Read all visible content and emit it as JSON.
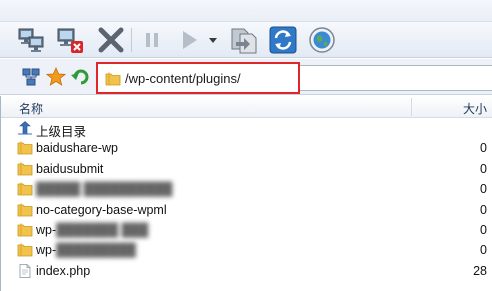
{
  "toolbar": {
    "buttons": [
      {
        "name": "connect-icon"
      },
      {
        "name": "disconnect-icon"
      },
      {
        "name": "cancel-icon"
      },
      {
        "name": "pause-icon"
      },
      {
        "name": "play-icon"
      },
      {
        "name": "dropdown-arrow-icon"
      },
      {
        "name": "copy-icon"
      },
      {
        "name": "refresh-icon"
      },
      {
        "name": "globe-icon"
      }
    ]
  },
  "address": {
    "path": "/wp-content/plugins/"
  },
  "list": {
    "header_name": "名称",
    "header_size": "大小",
    "up_label": "上级目录",
    "items": [
      {
        "label": "baidushare-wp",
        "size": "0",
        "type": "folder",
        "blurred": false
      },
      {
        "label": "baidusubmit",
        "size": "0",
        "type": "folder",
        "blurred": false
      },
      {
        "label": "",
        "size": "0",
        "type": "folder",
        "blurred": true
      },
      {
        "label": "no-category-base-wpml",
        "size": "0",
        "type": "folder",
        "blurred": false
      },
      {
        "label": "wp-",
        "size": "0",
        "type": "folder",
        "blurred": true
      },
      {
        "label": "wp-",
        "size": "0",
        "type": "folder",
        "blurred": true
      },
      {
        "label": "index.php",
        "size": "28",
        "type": "file",
        "blurred": false
      }
    ]
  },
  "colors": {
    "highlight_border": "#e0262a",
    "folder": "#f1c24c"
  }
}
